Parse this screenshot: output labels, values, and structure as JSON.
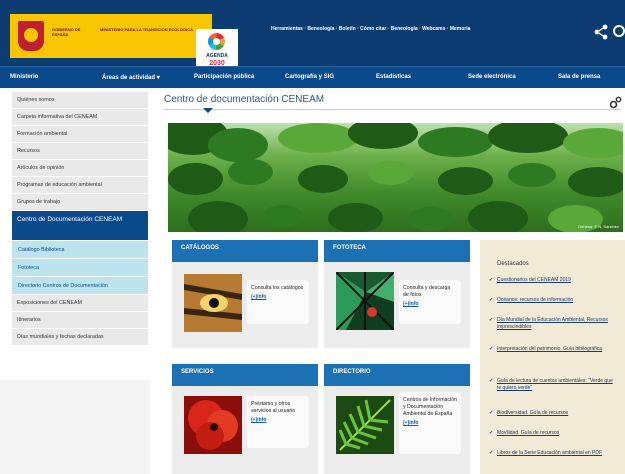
{
  "header": {
    "gov_text": "GOBIERNO DE ESPAÑA",
    "ministry_text": "MINISTERIO PARA LA TRANSICIÓN ECOLÓGICA",
    "agenda_label": "AGENDA",
    "agenda_year": "2030",
    "top_links": "Herramientas · Beneología · Boletín · Cómo citar · Beneología · Webcams · Memoria",
    "share_icon": "share-icon",
    "search_icon": "search-icon"
  },
  "nav": {
    "items": [
      "Ministerio",
      "Áreas de actividad ▾",
      "Participación pública",
      "Cartografía y SIG",
      "Estadísticas",
      "Sede electrónica",
      "Sala de prensa"
    ]
  },
  "sidebar": {
    "items_top": [
      "Quiénes somos",
      "Carpeta informativa del CENEAM",
      "Formación ambiental",
      "Recursos",
      "Artículos de opinión",
      "Programas de educación ambiental",
      "Grupos de trabajo"
    ],
    "active": "Centro de Documentación CENEAM",
    "sub_items": [
      "Catálogo Biblioteca",
      "Fototeca",
      "Directorio Centros de Documentación"
    ],
    "items_bottom": [
      "Exposiciones del CENEAM",
      "Itinerarios",
      "Días mundiales y fechas declaradas"
    ]
  },
  "main": {
    "title": "Centro de documentación CENEAM",
    "banner_credit": "Dehesa. © N. Sánchez",
    "cards": [
      {
        "header": "CATÁLOGOS",
        "text": "Consulta los catálogos",
        "link": "(+)info"
      },
      {
        "header": "FOTOTECA",
        "text": "Consulta y descarga de fotos",
        "link": "(+)info"
      },
      {
        "header": "SERVICIOS",
        "text": "Préstamo y otros servicios al usuario",
        "link": "(+)info"
      },
      {
        "header": "DIRECTORIO",
        "text": "Centros de Información y Documentación Ambiental de España",
        "link": "(+)info"
      }
    ]
  },
  "destacados": {
    "title": "Destacados",
    "items": [
      "Cuestionarios del CENEAM 2019",
      "Océanos: recursos de información",
      "Día Mundial de la Educación Ambiental. Recursos imprescindibles",
      "Interpretación del patrimonio. Guía bibliográfica",
      "Guía de lectura de cuentos ambientales: \"Verde que te quiero verde\"",
      "Biodiversidad. Guía de recursos",
      "Movilidad. Guía de recursos",
      "Libros de la Serie Educación ambiental en PDF"
    ]
  },
  "colors": {
    "header_bg": "#0d3c73",
    "nav_bg": "#0b4a8a",
    "card_header": "#1c70b4",
    "sidebar_sub": "#bde3ef",
    "destacados_bg": "#f1ead6"
  }
}
